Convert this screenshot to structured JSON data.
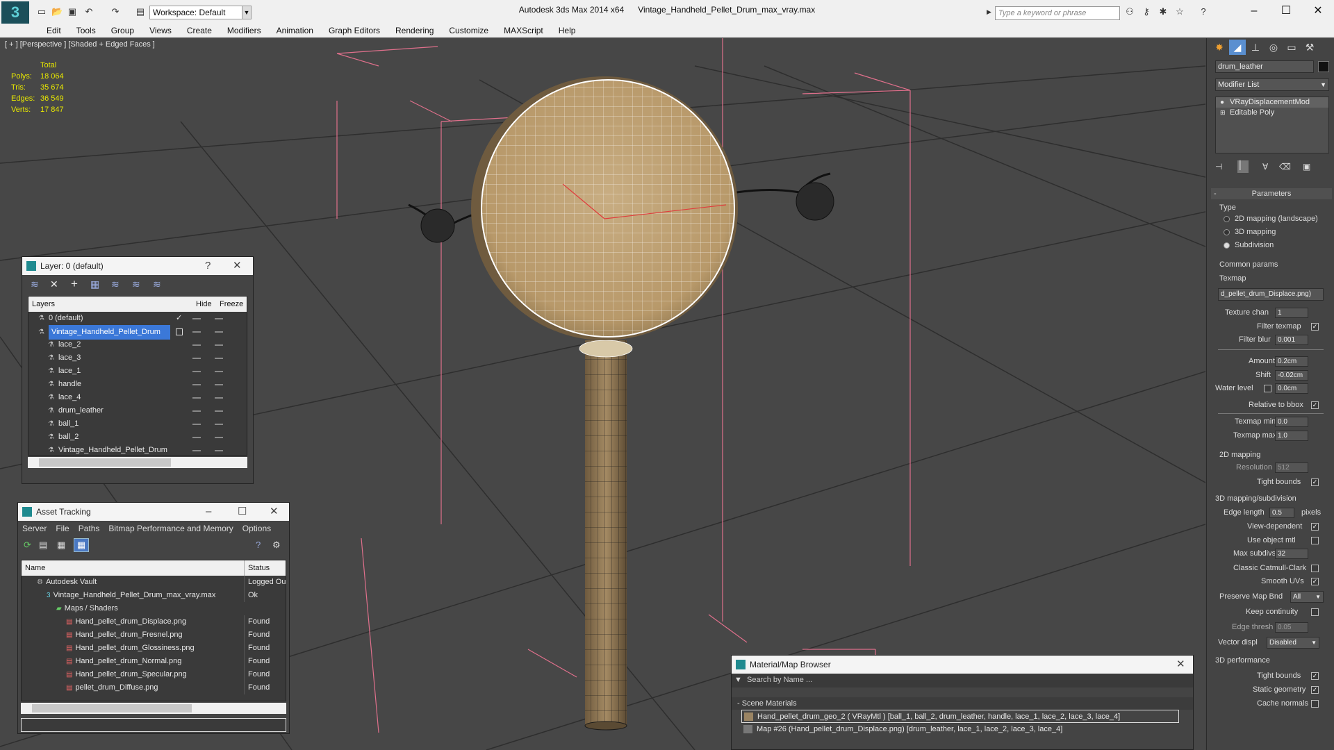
{
  "app": {
    "workspace": "Workspace: Default",
    "title_app": "Autodesk 3ds Max  2014 x64",
    "title_file": "Vintage_Handheld_Pellet_Drum_max_vray.max",
    "search_placeholder": "Type a keyword or phrase"
  },
  "menu": [
    "Edit",
    "Tools",
    "Group",
    "Views",
    "Create",
    "Modifiers",
    "Animation",
    "Graph Editors",
    "Rendering",
    "Customize",
    "MAXScript",
    "Help"
  ],
  "viewport": {
    "label": "[ + ] [Perspective ] [Shaded + Edged Faces ]",
    "stats_header": "Total",
    "stats": [
      {
        "k": "Polys:",
        "v": "18 064"
      },
      {
        "k": "Tris:",
        "v": "35 674"
      },
      {
        "k": "Edges:",
        "v": "36 549"
      },
      {
        "k": "Verts:",
        "v": "17 847"
      }
    ]
  },
  "layer_window": {
    "title": "Layer: 0 (default)",
    "help": "?",
    "col_layers": "Layers",
    "col_hide": "Hide",
    "col_freeze": "Freeze",
    "rows": [
      {
        "name": "0 (default)",
        "indent": 1,
        "selected": false,
        "check": "✓"
      },
      {
        "name": "Vintage_Handheld_Pellet_Drum",
        "indent": 1,
        "selected": true,
        "check": ""
      },
      {
        "name": "lace_2",
        "indent": 2,
        "selected": false,
        "check": ""
      },
      {
        "name": "lace_3",
        "indent": 2,
        "selected": false,
        "check": ""
      },
      {
        "name": "lace_1",
        "indent": 2,
        "selected": false,
        "check": ""
      },
      {
        "name": "handle",
        "indent": 2,
        "selected": false,
        "check": ""
      },
      {
        "name": "lace_4",
        "indent": 2,
        "selected": false,
        "check": ""
      },
      {
        "name": "drum_leather",
        "indent": 2,
        "selected": false,
        "check": ""
      },
      {
        "name": "ball_1",
        "indent": 2,
        "selected": false,
        "check": ""
      },
      {
        "name": "ball_2",
        "indent": 2,
        "selected": false,
        "check": ""
      },
      {
        "name": "Vintage_Handheld_Pellet_Drum",
        "indent": 2,
        "selected": false,
        "check": ""
      }
    ]
  },
  "asset_window": {
    "title": "Asset Tracking",
    "menu": [
      "Server",
      "File",
      "Paths",
      "Bitmap Performance and Memory",
      "Options"
    ],
    "col_name": "Name",
    "col_status": "Status",
    "rows": [
      {
        "name": "Autodesk Vault",
        "indent": 1,
        "status": "Logged Ou",
        "icon": "vault"
      },
      {
        "name": "Vintage_Handheld_Pellet_Drum_max_vray.max",
        "indent": 2,
        "status": "Ok",
        "icon": "max"
      },
      {
        "name": "Maps / Shaders",
        "indent": 3,
        "status": "",
        "icon": "folder"
      },
      {
        "name": "Hand_pellet_drum_Displace.png",
        "indent": 4,
        "status": "Found",
        "icon": "png"
      },
      {
        "name": "Hand_pellet_drum_Fresnel.png",
        "indent": 4,
        "status": "Found",
        "icon": "png"
      },
      {
        "name": "Hand_pellet_drum_Glossiness.png",
        "indent": 4,
        "status": "Found",
        "icon": "png"
      },
      {
        "name": "Hand_pellet_drum_Normal.png",
        "indent": 4,
        "status": "Found",
        "icon": "png"
      },
      {
        "name": "Hand_pellet_drum_Specular.png",
        "indent": 4,
        "status": "Found",
        "icon": "png"
      },
      {
        "name": "pellet_drum_Diffuse.png",
        "indent": 4,
        "status": "Found",
        "icon": "png"
      }
    ]
  },
  "material_browser": {
    "title": "Material/Map Browser",
    "search_placeholder": "Search by Name ...",
    "section": "- Scene Materials",
    "items": [
      "Hand_pellet_drum_geo_2  ( VRayMtl )  [ball_1, ball_2, drum_leather, handle, lace_1, lace_2, lace_3, lace_4]",
      "Map #26 (Hand_pellet_drum_Displace.png)  [drum_leather, lace_1, lace_2, lace_3, lace_4]"
    ]
  },
  "command_panel": {
    "object_name": "drum_leather",
    "modifier_list": "Modifier List",
    "stack": [
      "VRayDisplacementMod",
      "Editable Poly"
    ],
    "parameters": "Parameters",
    "type_label": "Type",
    "type_options": [
      {
        "label": "2D mapping (landscape)",
        "on": false
      },
      {
        "label": "3D mapping",
        "on": false
      },
      {
        "label": "Subdivision",
        "on": true
      }
    ],
    "common_params": "Common params",
    "texmap_label": "Texmap",
    "texmap_value": "d_pellet_drum_Displace.png)",
    "texture_chan_label": "Texture chan",
    "texture_chan": "1",
    "filter_texmap": "Filter texmap",
    "filter_blur_label": "Filter blur",
    "filter_blur": "0.001",
    "amount_label": "Amount",
    "amount": "0.2cm",
    "shift_label": "Shift",
    "shift": "-0.02cm",
    "water_level_label": "Water level",
    "water_level": "0.0cm",
    "relative_bbox": "Relative to bbox",
    "texmap_min_label": "Texmap min",
    "texmap_min": "0.0",
    "texmap_max_label": "Texmap max",
    "texmap_max": "1.0",
    "mapping2d": "2D mapping",
    "resolution_label": "Resolution",
    "resolution": "512",
    "tight_bounds": "Tight bounds",
    "mapping3d": "3D mapping/subdivision",
    "edge_length_label": "Edge length",
    "edge_length": "0.5",
    "pixels": "pixels",
    "view_dependent": "View-dependent",
    "use_object_mtl": "Use object mtl",
    "max_subdivs_label": "Max subdivs",
    "max_subdivs": "32",
    "classic_catmull": "Classic Catmull-Clark",
    "smooth_uvs": "Smooth UVs",
    "preserve_map_label": "Preserve Map Bnd",
    "preserve_map": "All",
    "keep_continuity": "Keep continuity",
    "edge_thresh_label": "Edge thresh",
    "edge_thresh": "0.05",
    "vector_displ_label": "Vector displ",
    "vector_displ": "Disabled",
    "perf3d": "3D performance",
    "tight_bounds2": "Tight bounds",
    "static_geometry": "Static geometry",
    "cache_normals": "Cache normals"
  }
}
